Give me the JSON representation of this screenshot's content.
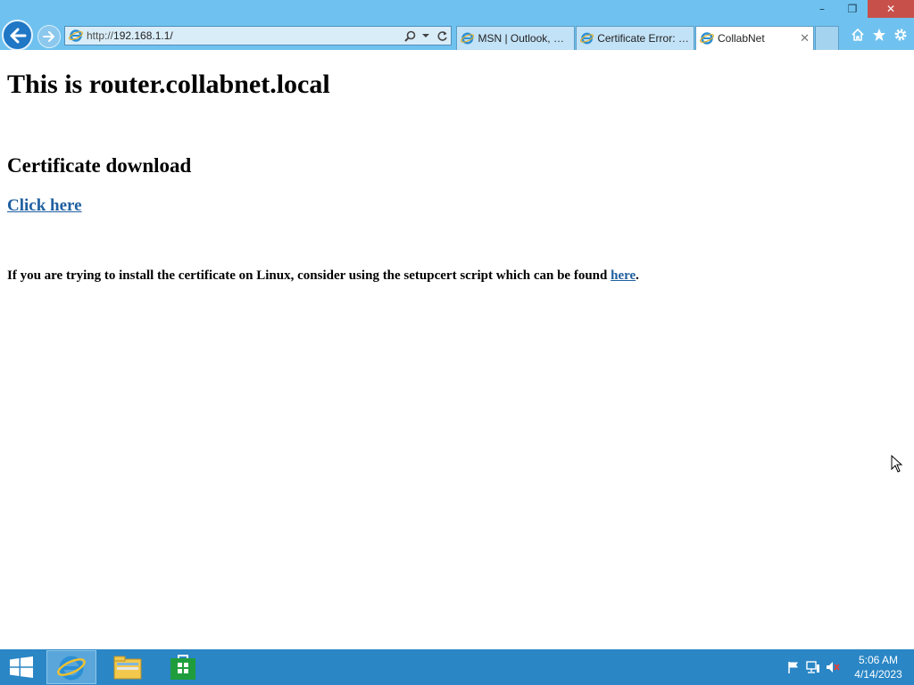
{
  "window": {
    "minimize_label": "–",
    "restore_label": "❐",
    "close_label": "✕"
  },
  "address": {
    "prefix": "http://",
    "host": "192.168.1.1/"
  },
  "tabs": [
    {
      "label": "MSN | Outlook, Of...",
      "active": false
    },
    {
      "label": "Certificate Error: N...",
      "active": false
    },
    {
      "label": "CollabNet",
      "active": true,
      "close_label": "✕"
    }
  ],
  "page": {
    "heading": "This is router.collabnet.local",
    "cert_heading": "Certificate download",
    "cert_link": "Click here",
    "linux_note": "If you are trying to install the certificate on Linux, consider using the setupcert script which can be found ",
    "linux_link": "here",
    "linux_end": "."
  },
  "taskbar": {
    "time": "5:06 AM",
    "date": "4/14/2023"
  },
  "icons": {
    "back": "back-arrow-icon",
    "forward": "forward-arrow-icon",
    "search": "search-icon",
    "refresh": "refresh-icon",
    "home": "home-icon",
    "favorites": "star-icon",
    "tools": "gear-icon"
  },
  "colors": {
    "chrome": "#6fc2ef",
    "taskbar": "#2a86c5",
    "link": "#1f5fa0",
    "close": "#c7504b"
  }
}
